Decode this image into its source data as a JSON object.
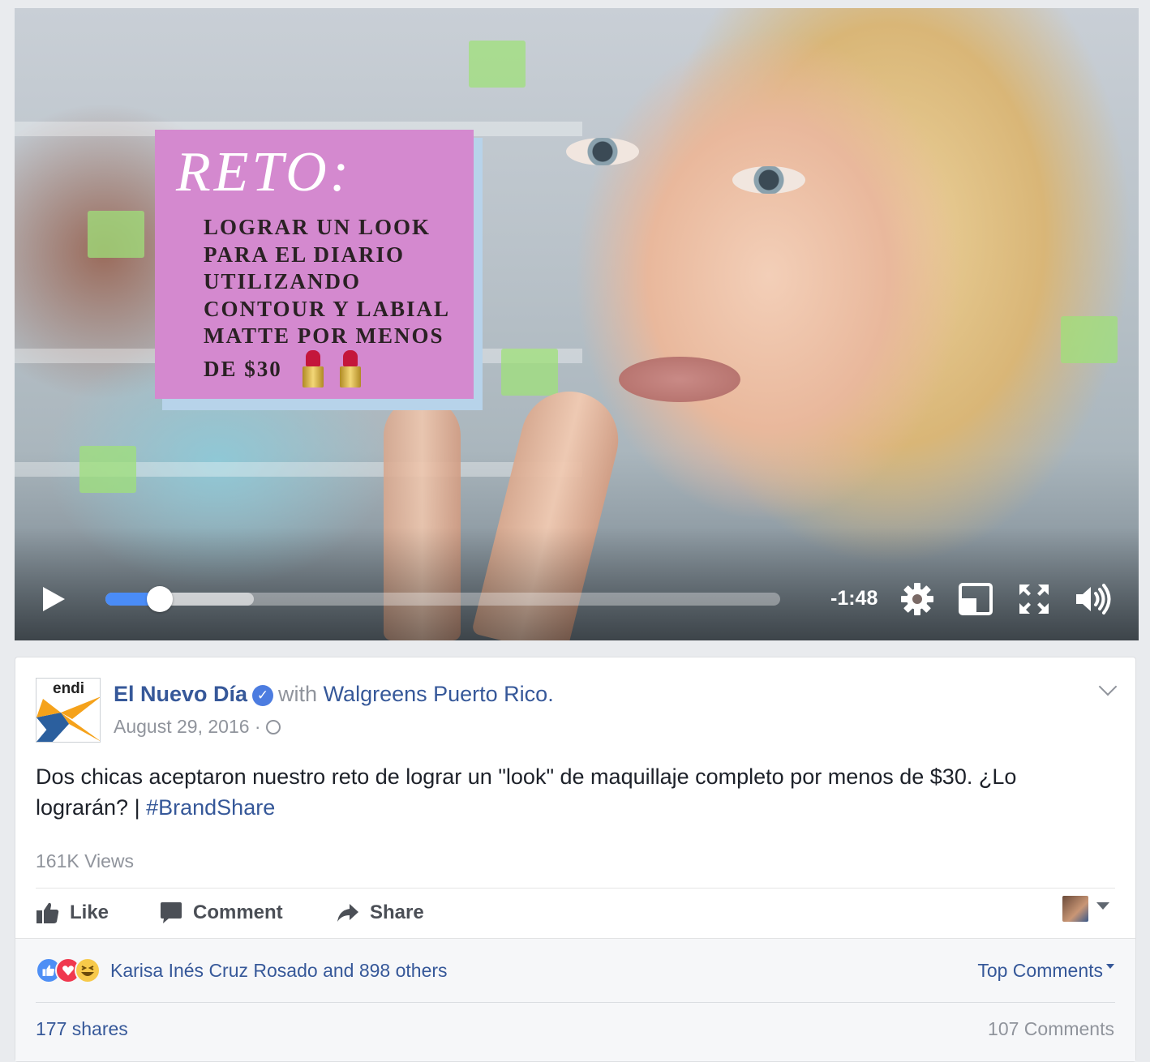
{
  "video": {
    "overlay_title": "RETO:",
    "overlay_lines": [
      "LOGRAR UN LOOK",
      "PARA EL DIARIO",
      "UTILIZANDO",
      "CONTOUR Y LABIAL",
      "MATTE POR MENOS",
      "DE $30"
    ],
    "time_remaining": "-1:48",
    "progress_fraction": 0.08,
    "buffered_fraction": 0.22,
    "icons": [
      "play-icon",
      "settings-gear-icon",
      "picture-in-picture-icon",
      "fullscreen-icon",
      "volume-icon"
    ]
  },
  "post": {
    "avatar_text": "endi",
    "page_name": "El Nuevo Día",
    "with_text": "with",
    "tagged_page": "Walgreens Puerto Rico.",
    "date": "August 29, 2016 ·",
    "text_main": "Dos chicas aceptaron nuestro reto de lograr un \"look\" de maquillaje completo por menos de $30. ¿Lo lograrán? | ",
    "hashtag": "#BrandShare",
    "views": "161K Views"
  },
  "actions": {
    "like": "Like",
    "comment": "Comment",
    "share": "Share"
  },
  "footer": {
    "reaction_names": "Karisa Inés Cruz Rosado and 898 others",
    "top_comments": "Top Comments",
    "shares": "177 shares",
    "comments_count": "107 Comments"
  },
  "colors": {
    "link": "#365899",
    "overlay_pink": "#d489cf",
    "progress_blue": "#4a8cf7"
  }
}
